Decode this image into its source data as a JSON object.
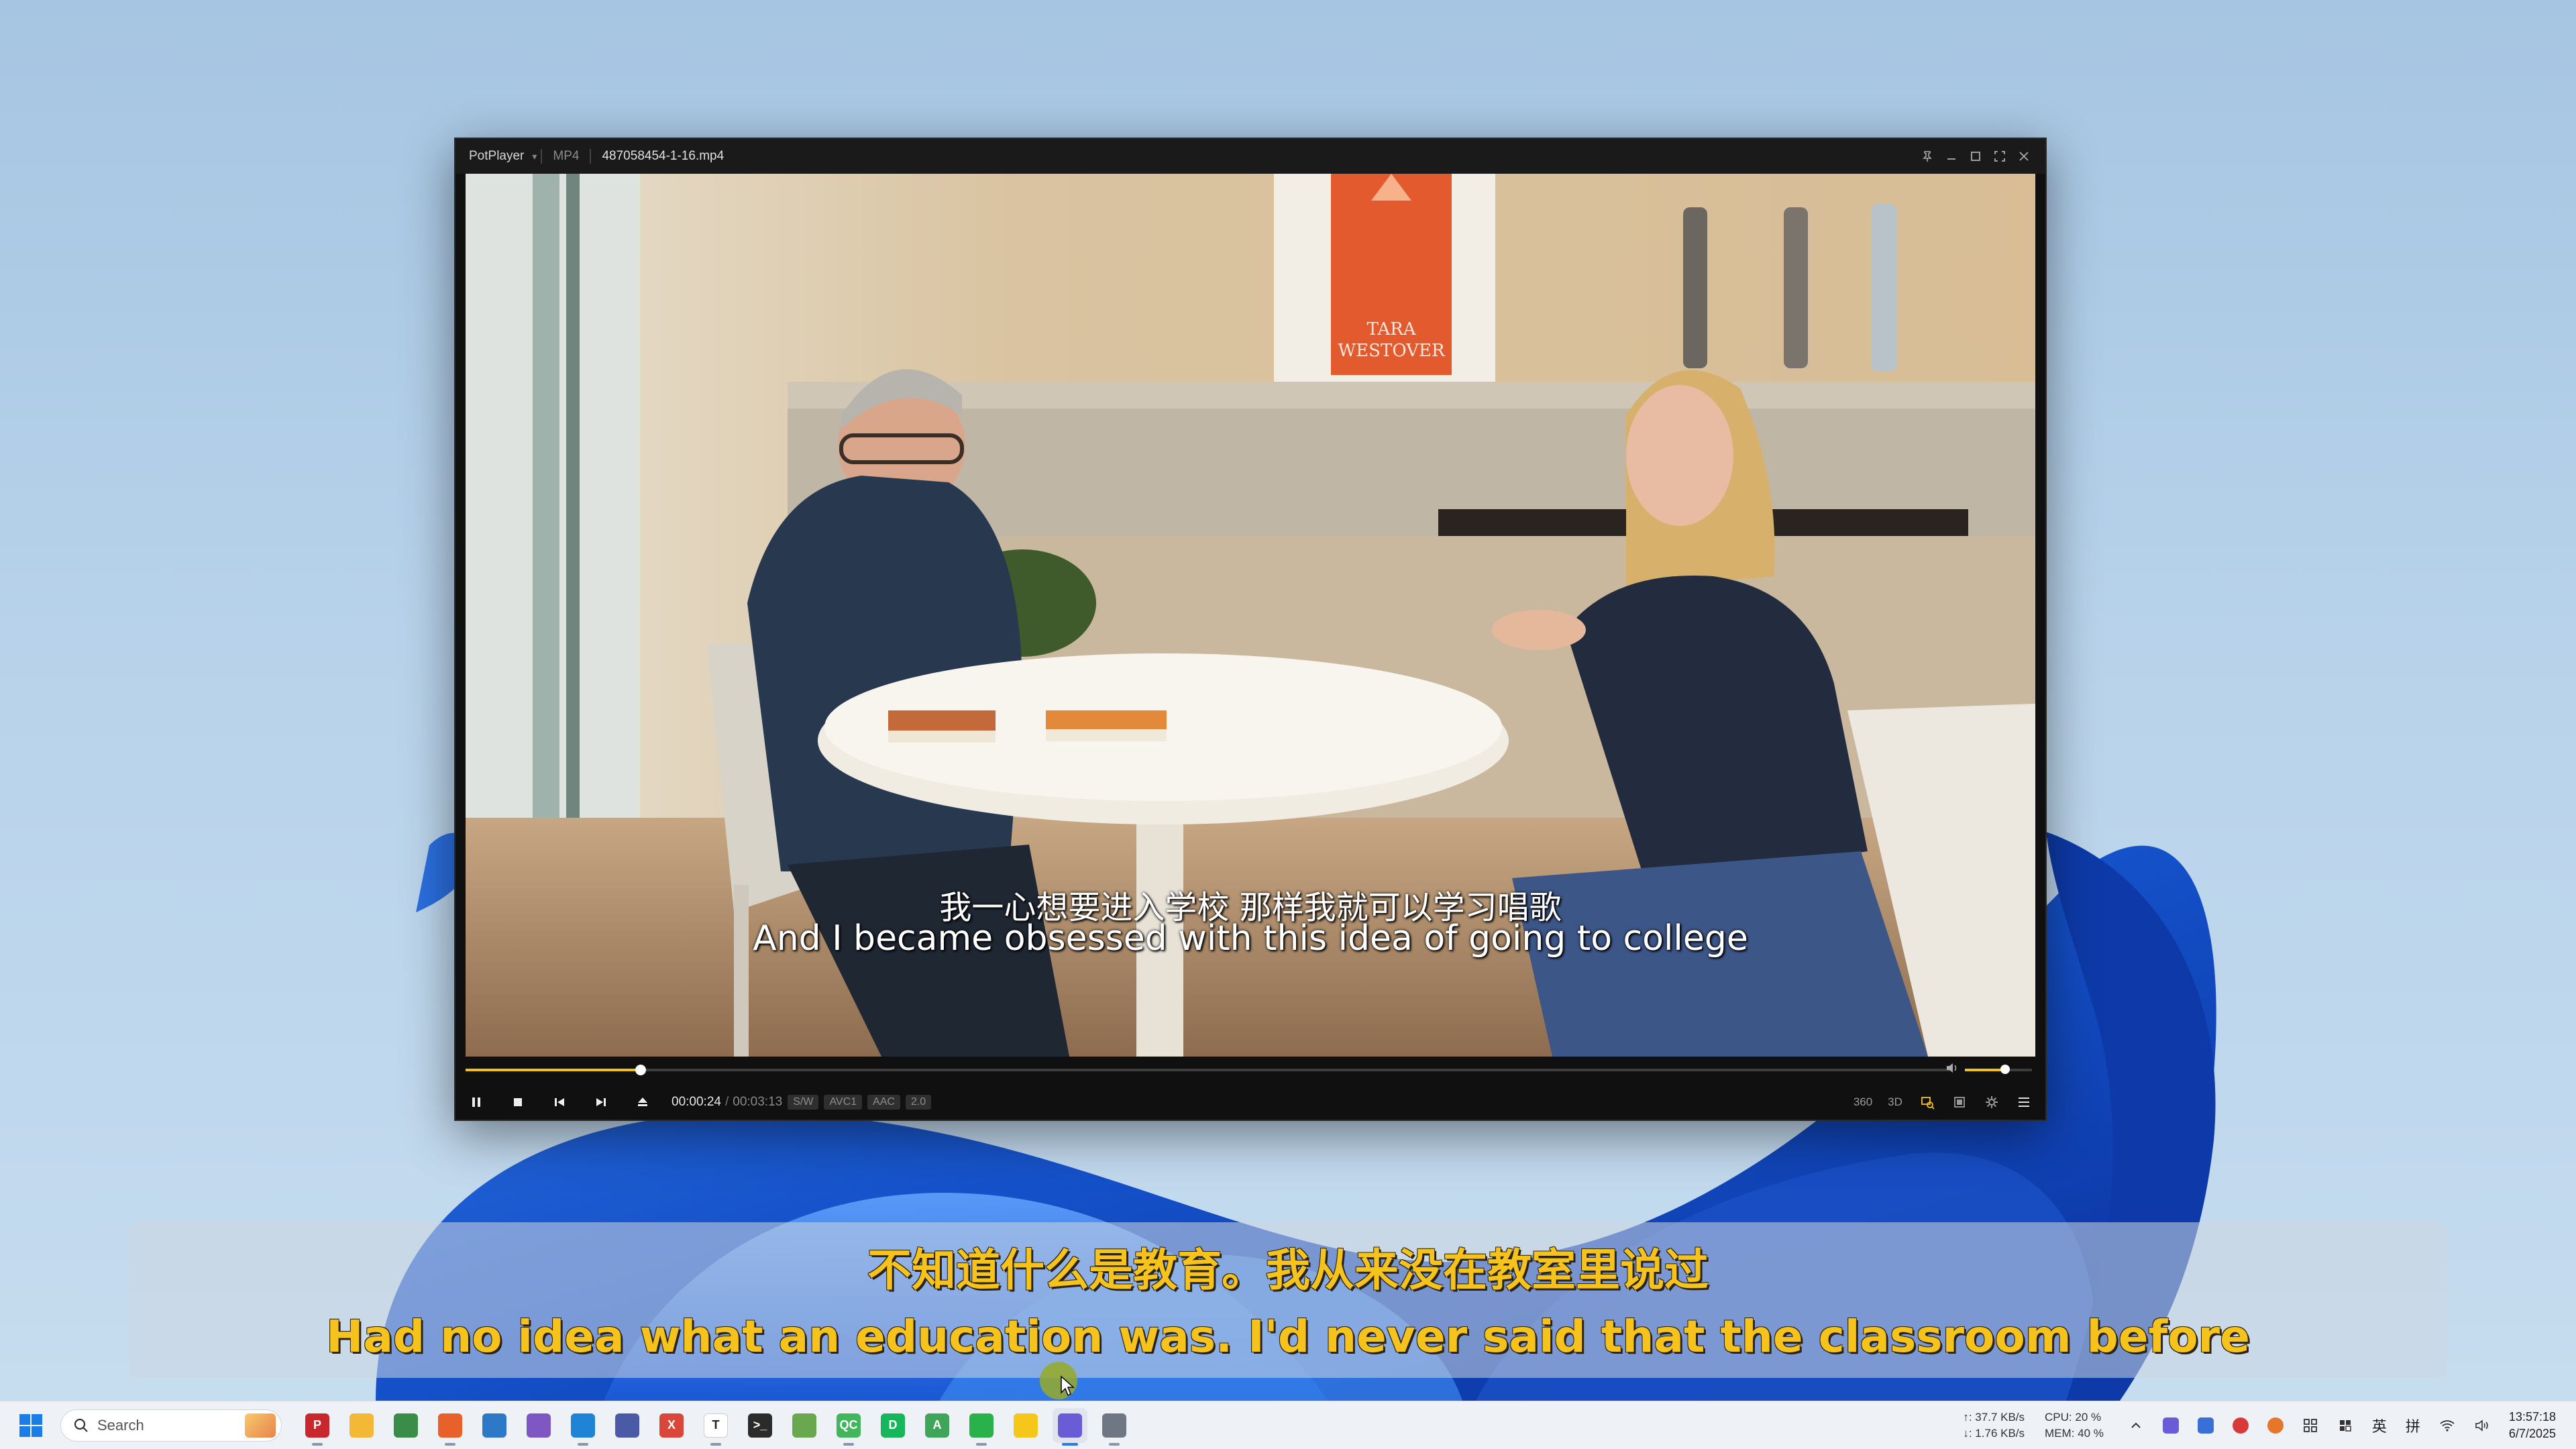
{
  "window": {
    "app_name": "PotPlayer",
    "format": "MP4",
    "file_name": "487058454-1-16.mp4"
  },
  "video": {
    "poster_text_line1": "TARA",
    "poster_text_line2": "WESTOVER",
    "subtitle_zh": "我一心想要进入学校 那样我就可以学习唱歌",
    "subtitle_en": "And I became obsessed with this idea of going to college"
  },
  "playback": {
    "progress": 0.118,
    "volume": 0.6,
    "current_time": "00:00:24",
    "separator": "/",
    "total_time": "00:03:13",
    "badges": [
      "S/W",
      "AVC1",
      "AAC",
      "2.0"
    ]
  },
  "right_controls": {
    "btn_360": "360",
    "btn_3d": "3D"
  },
  "overlay_subtitle": {
    "zh": "不知道什么是教育。我从来没在教室里说过",
    "en": "Had no idea what an education was. I'd never said that the classroom before"
  },
  "taskbar": {
    "search_placeholder": "Search",
    "net_up": "↑: 37.7 KB/s",
    "net_down": "↓: 1.76 KB/s",
    "cpu": "CPU: 20 %",
    "mem": "MEM: 40 %",
    "ime_lang": "英",
    "ime_mode": "拼",
    "time": "13:57:18",
    "date": "6/7/2025",
    "apps": [
      {
        "name": "pdf-reader",
        "color": "#c8282d",
        "glyph": "P"
      },
      {
        "name": "file-explorer",
        "color": "#f3b836",
        "glyph": ""
      },
      {
        "name": "chrome",
        "color": "#3a8d48",
        "glyph": ""
      },
      {
        "name": "firefox",
        "color": "#e8602a",
        "glyph": ""
      },
      {
        "name": "magnifier",
        "color": "#2e79c7",
        "glyph": ""
      },
      {
        "name": "visual-studio",
        "color": "#7e57c2",
        "glyph": ""
      },
      {
        "name": "vscode",
        "color": "#1f84d6",
        "glyph": ""
      },
      {
        "name": "network-tool",
        "color": "#4b5aa6",
        "glyph": ""
      },
      {
        "name": "xmind",
        "color": "#d9463a",
        "glyph": "X"
      },
      {
        "name": "typora",
        "color": "#ffffff",
        "glyph": "T"
      },
      {
        "name": "terminal",
        "color": "#2b2b2b",
        "glyph": ">_"
      },
      {
        "name": "notepad",
        "color": "#6aa84f",
        "glyph": ""
      },
      {
        "name": "qt-creator",
        "color": "#41b65d",
        "glyph": "QC"
      },
      {
        "name": "wechat-dev",
        "color": "#17b55c",
        "glyph": "D"
      },
      {
        "name": "android-studio",
        "color": "#3ea55a",
        "glyph": "A"
      },
      {
        "name": "wechat",
        "color": "#29b14a",
        "glyph": ""
      },
      {
        "name": "sticky-notes",
        "color": "#f5c71a",
        "glyph": ""
      },
      {
        "name": "potplayer",
        "color": "#6a5cd6",
        "glyph": ""
      },
      {
        "name": "media-app",
        "color": "#6f7785",
        "glyph": ""
      }
    ]
  },
  "colors": {
    "accent": "#f0c020",
    "overlay_text": "#f6c21c"
  }
}
